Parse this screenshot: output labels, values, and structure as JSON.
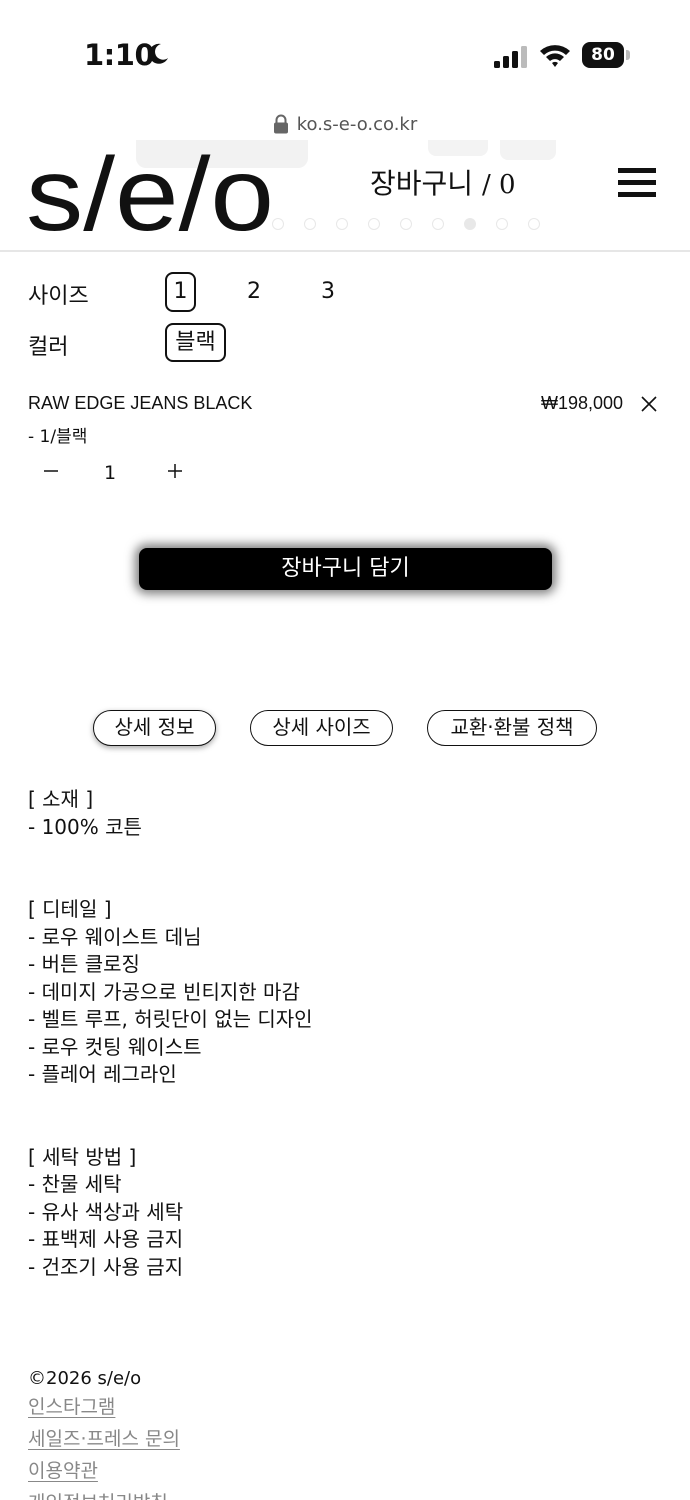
{
  "status_bar": {
    "time": "1:10",
    "battery": "80",
    "icons": [
      "moon-icon",
      "cellular-signal-icon",
      "wifi-icon",
      "battery-icon"
    ]
  },
  "browser": {
    "url": "ko.s-e-o.co.kr",
    "icon": "lock-icon"
  },
  "header": {
    "logo_text": "s/e/o",
    "cart_label": "장바구니",
    "cart_count": "/ 0",
    "menu_icon": "hamburger-menu-icon",
    "carousel_dots": 9,
    "carousel_active_index": 6
  },
  "options": {
    "size_label": "사이즈",
    "sizes": [
      "1",
      "2",
      "3"
    ],
    "selected_size": "1",
    "color_label": "컬러",
    "colors": [
      "블랙"
    ],
    "selected_color": "블랙"
  },
  "cart_item": {
    "name": "RAW EDGE JEANS BLACK",
    "variant": "- 1/블랙",
    "price": "₩198,000",
    "remove_icon": "close-icon",
    "quantity": "1",
    "minus_icon": "minus-icon",
    "plus_icon": "plus-icon"
  },
  "add_to_cart_label": "장바구니 담기",
  "tabs": [
    {
      "label": "상세 정보",
      "active": true
    },
    {
      "label": "상세 사이즈",
      "active": false
    },
    {
      "label": "교환·환불 정책",
      "active": false
    }
  ],
  "details": {
    "material": [
      "[ 소재 ]",
      "- 100% 코튼"
    ],
    "detail": [
      "[ 디테일 ]",
      "- 로우 웨이스트 데님",
      "- 버튼 클로징",
      "- 데미지 가공으로 빈티지한 마감",
      "- 벨트 루프, 허릿단이 없는 디자인",
      "- 로우 컷팅 웨이스트",
      "- 플레어 레그라인"
    ],
    "care": [
      "[ 세탁 방법 ]",
      "- 찬물 세탁",
      "- 유사 색상과 세탁",
      "- 표백제 사용 금지",
      "- 건조기 사용 금지"
    ]
  },
  "footer": {
    "copyright": "©2026 s/e/o",
    "links": [
      "인스타그램",
      "세일즈·프레스 문의",
      "이용약관",
      "개인정보처리방침"
    ]
  }
}
